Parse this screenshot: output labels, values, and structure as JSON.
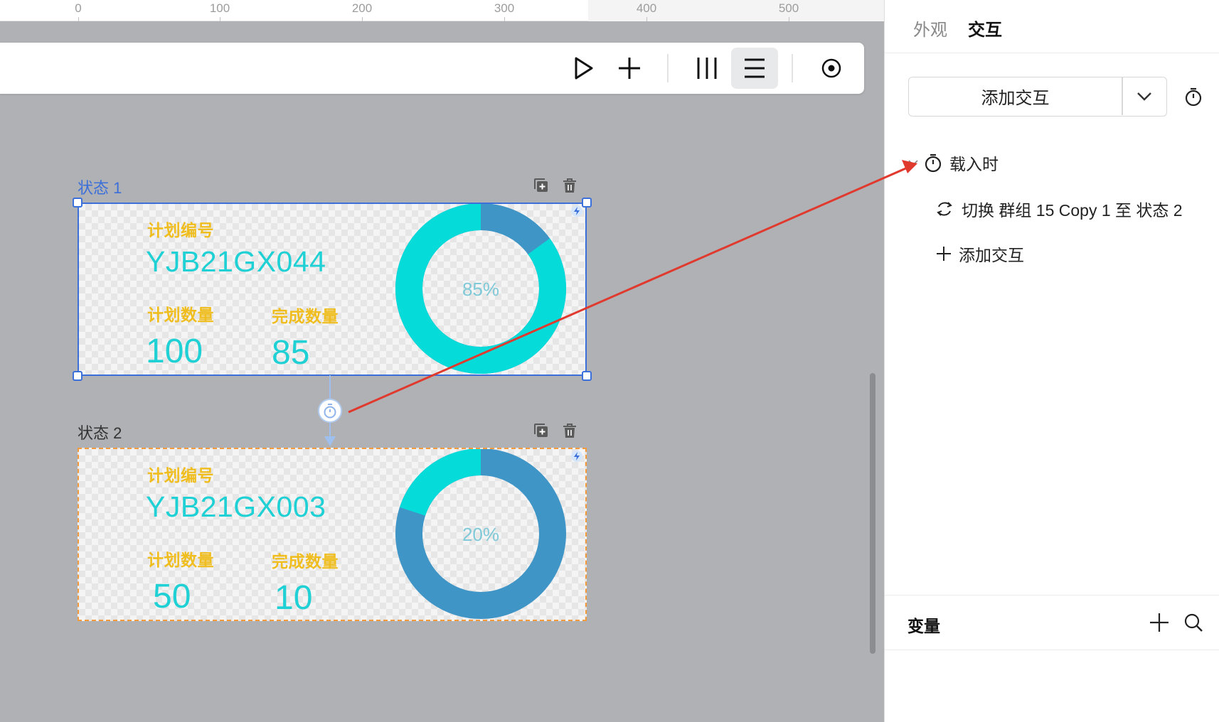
{
  "ruler": {
    "ticks": [
      "0",
      "100",
      "200",
      "300",
      "400",
      "500"
    ]
  },
  "toolbar": {
    "icons": [
      "play-icon",
      "plus-icon",
      "columns-icon",
      "rows-icon",
      "record-icon"
    ],
    "active": "rows-icon"
  },
  "states": [
    {
      "title": "状态 1",
      "plan_no_label": "计划编号",
      "plan_no": "YJB21GX044",
      "plan_qty_label": "计划数量",
      "plan_qty": "100",
      "done_qty_label": "完成数量",
      "done_qty": "85",
      "percent_label": "85%",
      "percent": 0.85,
      "selected": true
    },
    {
      "title": "状态 2",
      "plan_no_label": "计划编号",
      "plan_no": "YJB21GX003",
      "plan_qty_label": "计划数量",
      "plan_qty": "50",
      "done_qty_label": "完成数量",
      "done_qty": "10",
      "percent_label": "20%",
      "percent": 0.2,
      "selected": false
    }
  ],
  "panel": {
    "tabs": [
      "外观",
      "交互"
    ],
    "active_tab": "交互",
    "add_interaction_button": "添加交互",
    "trigger": "载入时",
    "action": "切换 群组 15 Copy 1 至 状态 2",
    "add_interaction_link": "添加交互",
    "variables_title": "变量"
  },
  "colors": {
    "accent_blue": "#3b6fd9",
    "donut_progress": "#05dbd8",
    "donut_track": "#4095c7",
    "label_yellow": "#f0bd1e",
    "value_cyan": "#1fd0d4",
    "arrow_red": "#e03a2f",
    "state2_border": "#f29a3c"
  }
}
